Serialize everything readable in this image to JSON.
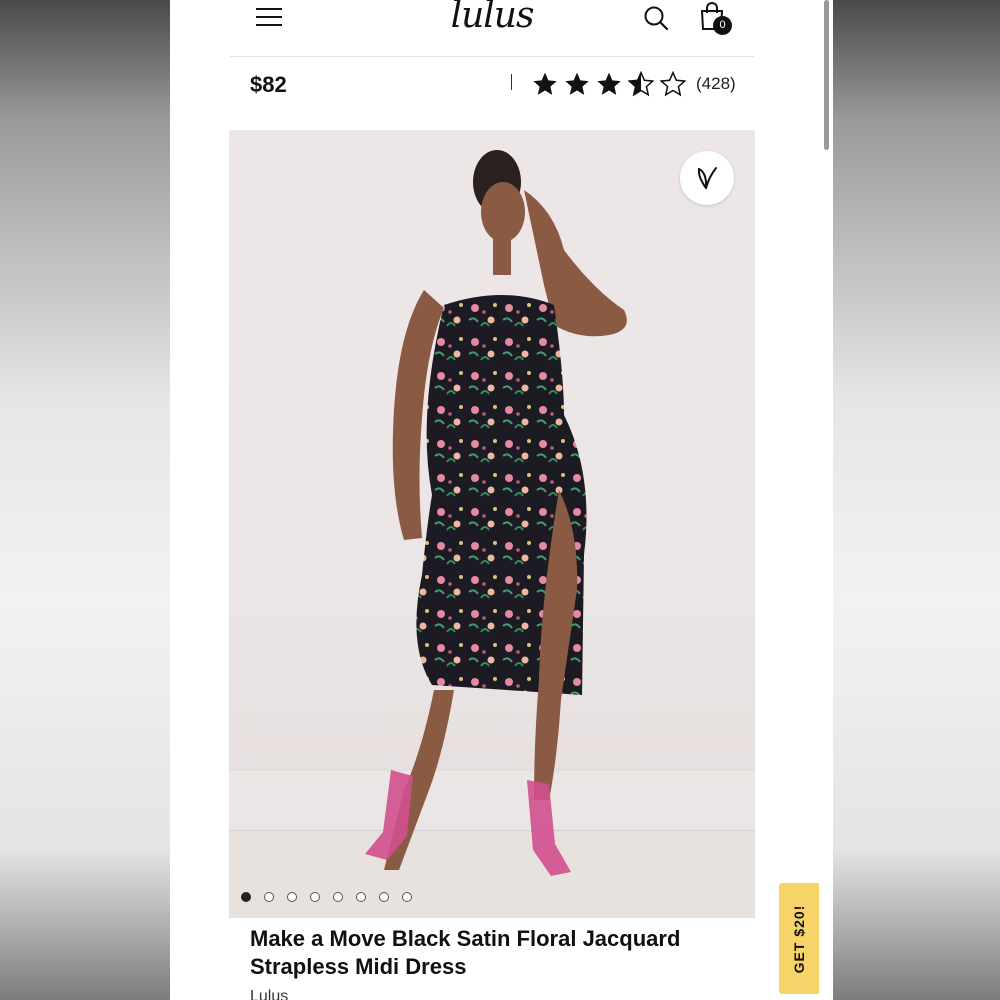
{
  "header": {
    "logo_text": "lulus",
    "menu_icon": "hamburger-menu-icon",
    "search_icon": "search-icon",
    "bag_icon": "shopping-bag-icon",
    "bag_count": "0"
  },
  "product": {
    "price": "$82",
    "rating": 3.5,
    "rating_max": 5,
    "review_count": "(428)",
    "title": "Make a Move Black Satin Floral Jacquard Strapless Midi Dress",
    "brand": "Lulus"
  },
  "gallery": {
    "image_count": 8,
    "active_index": 0,
    "wishlist_icon": "heart-icon"
  },
  "promo": {
    "label": "GET $20!"
  },
  "colors": {
    "promo_bg": "#f7d46a",
    "text": "#111111"
  }
}
